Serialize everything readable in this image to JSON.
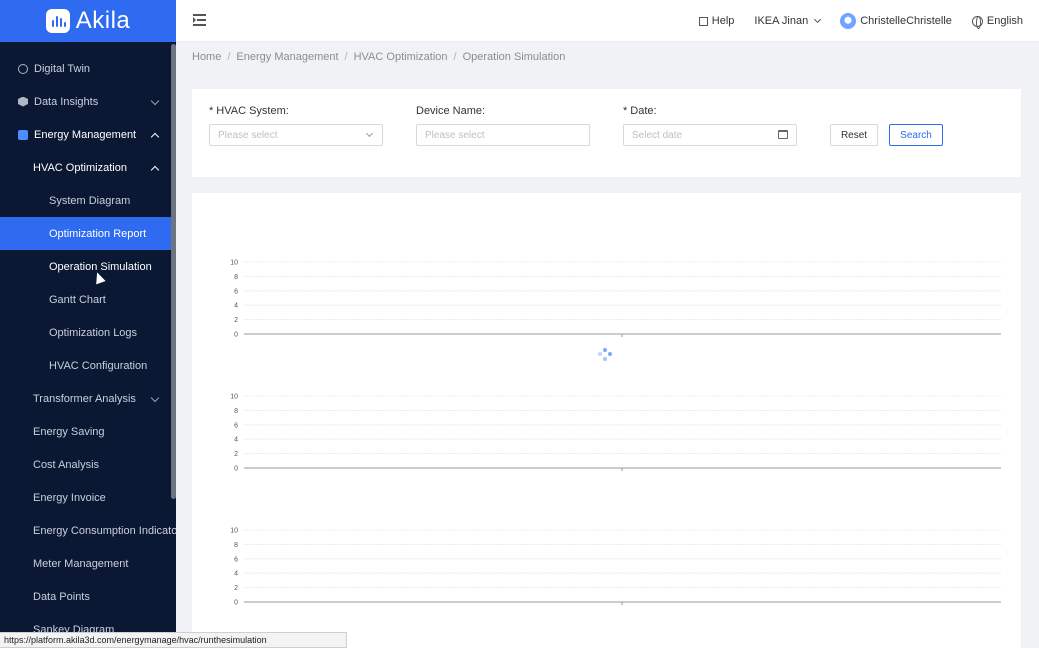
{
  "app": {
    "name": "Akila"
  },
  "sidebar": {
    "items": [
      {
        "label": "Digital Twin",
        "icon": "digital-twin-icon"
      },
      {
        "label": "Data Insights",
        "icon": "data-insights-icon"
      },
      {
        "label": "Energy Management",
        "icon": "energy-management-icon"
      },
      {
        "label": "HVAC Optimization"
      },
      {
        "label": "System Diagram"
      },
      {
        "label": "Optimization Report"
      },
      {
        "label": "Operation Simulation"
      },
      {
        "label": "Gantt Chart"
      },
      {
        "label": "Optimization Logs"
      },
      {
        "label": "HVAC Configuration"
      },
      {
        "label": "Transformer Analysis"
      },
      {
        "label": "Energy Saving"
      },
      {
        "label": "Cost Analysis"
      },
      {
        "label": "Energy Invoice"
      },
      {
        "label": "Energy Consumption Indicators"
      },
      {
        "label": "Meter Management"
      },
      {
        "label": "Data Points"
      },
      {
        "label": "Sankey Diagram"
      }
    ]
  },
  "header": {
    "help": "Help",
    "site": "IKEA Jinan",
    "user": "ChristelleChristelle",
    "language": "English"
  },
  "breadcrumb": [
    "Home",
    "Energy Management",
    "HVAC Optimization",
    "Operation Simulation"
  ],
  "filters": {
    "hvac_system": {
      "label": "HVAC System",
      "placeholder": "Please select",
      "required": "*"
    },
    "device_name": {
      "label": "Device Name",
      "placeholder": "Please select"
    },
    "date": {
      "label": "Date",
      "placeholder": "Select date",
      "required": "*"
    },
    "reset": "Reset",
    "search": "Search"
  },
  "chart_data": [
    {
      "type": "line",
      "yticks": [
        "10",
        "8",
        "6",
        "4",
        "2",
        "0"
      ],
      "ylim": [
        0,
        10
      ],
      "series": []
    },
    {
      "type": "line",
      "yticks": [
        "10",
        "8",
        "6",
        "4",
        "2",
        "0"
      ],
      "ylim": [
        0,
        10
      ],
      "series": []
    },
    {
      "type": "line",
      "yticks": [
        "10",
        "8",
        "6",
        "4",
        "2",
        "0"
      ],
      "ylim": [
        0,
        10
      ],
      "series": []
    }
  ],
  "status_bar": {
    "url": "https://platform.akila3d.com/energymanage/hvac/runthesimulation"
  }
}
